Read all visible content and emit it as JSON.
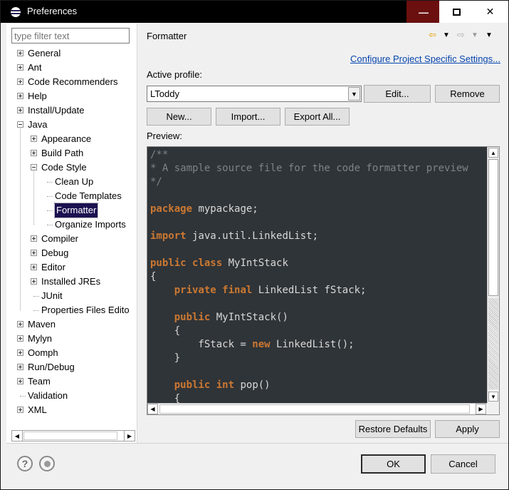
{
  "window": {
    "title": "Preferences"
  },
  "filter": {
    "placeholder": "type filter text"
  },
  "tree": [
    {
      "label": "General",
      "level": 0,
      "expander": "plus"
    },
    {
      "label": "Ant",
      "level": 0,
      "expander": "plus"
    },
    {
      "label": "Code Recommenders",
      "level": 0,
      "expander": "plus"
    },
    {
      "label": "Help",
      "level": 0,
      "expander": "plus"
    },
    {
      "label": "Install/Update",
      "level": 0,
      "expander": "plus"
    },
    {
      "label": "Java",
      "level": 0,
      "expander": "minus"
    },
    {
      "label": "Appearance",
      "level": 1,
      "expander": "plus"
    },
    {
      "label": "Build Path",
      "level": 1,
      "expander": "plus"
    },
    {
      "label": "Code Style",
      "level": 1,
      "expander": "minus"
    },
    {
      "label": "Clean Up",
      "level": 2,
      "expander": "none"
    },
    {
      "label": "Code Templates",
      "level": 2,
      "expander": "none"
    },
    {
      "label": "Formatter",
      "level": 2,
      "expander": "none",
      "selected": true
    },
    {
      "label": "Organize Imports",
      "level": 2,
      "expander": "none"
    },
    {
      "label": "Compiler",
      "level": 1,
      "expander": "plus"
    },
    {
      "label": "Debug",
      "level": 1,
      "expander": "plus"
    },
    {
      "label": "Editor",
      "level": 1,
      "expander": "plus"
    },
    {
      "label": "Installed JREs",
      "level": 1,
      "expander": "plus"
    },
    {
      "label": "JUnit",
      "level": 1,
      "expander": "none"
    },
    {
      "label": "Properties Files Edito",
      "level": 1,
      "expander": "none"
    },
    {
      "label": "Maven",
      "level": 0,
      "expander": "plus"
    },
    {
      "label": "Mylyn",
      "level": 0,
      "expander": "plus"
    },
    {
      "label": "Oomph",
      "level": 0,
      "expander": "plus"
    },
    {
      "label": "Run/Debug",
      "level": 0,
      "expander": "plus"
    },
    {
      "label": "Team",
      "level": 0,
      "expander": "plus"
    },
    {
      "label": "Validation",
      "level": 0,
      "expander": "none"
    },
    {
      "label": "XML",
      "level": 0,
      "expander": "plus"
    }
  ],
  "page": {
    "title": "Formatter",
    "configure_link": "Configure Project Specific Settings...",
    "active_profile_label": "Active profile:",
    "profile_value": "LToddy",
    "edit_button": "Edit...",
    "remove_button": "Remove",
    "new_button": "New...",
    "import_button": "Import...",
    "export_button": "Export All...",
    "preview_label": "Preview:",
    "restore_button": "Restore Defaults",
    "apply_button": "Apply"
  },
  "preview_code": [
    [
      {
        "t": "/**",
        "c": "cm"
      }
    ],
    [
      {
        "t": "* A sample source file for the code formatter preview",
        "c": "cm"
      }
    ],
    [
      {
        "t": "*/",
        "c": "cm"
      }
    ],
    [],
    [
      {
        "t": "package",
        "c": "kw"
      },
      {
        "t": " mypackage;",
        "c": "plain"
      }
    ],
    [],
    [
      {
        "t": "import",
        "c": "kw"
      },
      {
        "t": " java.util.LinkedList;",
        "c": "plain"
      }
    ],
    [],
    [
      {
        "t": "public",
        "c": "kw"
      },
      {
        "t": " ",
        "c": "plain"
      },
      {
        "t": "class",
        "c": "kw"
      },
      {
        "t": " MyIntStack",
        "c": "plain"
      }
    ],
    [
      {
        "t": "{",
        "c": "plain"
      }
    ],
    [
      {
        "t": "    ",
        "c": "plain"
      },
      {
        "t": "private",
        "c": "kw"
      },
      {
        "t": " ",
        "c": "plain"
      },
      {
        "t": "final",
        "c": "kw"
      },
      {
        "t": " LinkedList fStack;",
        "c": "plain"
      }
    ],
    [],
    [
      {
        "t": "    ",
        "c": "plain"
      },
      {
        "t": "public",
        "c": "kw"
      },
      {
        "t": " MyIntStack()",
        "c": "plain"
      }
    ],
    [
      {
        "t": "    {",
        "c": "plain"
      }
    ],
    [
      {
        "t": "        fStack = ",
        "c": "plain"
      },
      {
        "t": "new",
        "c": "kw"
      },
      {
        "t": " LinkedList();",
        "c": "plain"
      }
    ],
    [
      {
        "t": "    }",
        "c": "plain"
      }
    ],
    [],
    [
      {
        "t": "    ",
        "c": "plain"
      },
      {
        "t": "public",
        "c": "kw"
      },
      {
        "t": " ",
        "c": "plain"
      },
      {
        "t": "int",
        "c": "kw"
      },
      {
        "t": " pop()",
        "c": "plain"
      }
    ],
    [
      {
        "t": "    {",
        "c": "plain"
      }
    ]
  ],
  "dialog": {
    "ok_button": "OK",
    "cancel_button": "Cancel"
  },
  "icons": {
    "help": "help-icon",
    "import_export": "import-export-icon",
    "back": "back-arrow-icon",
    "forward": "forward-arrow-icon",
    "menu": "view-menu-icon"
  },
  "colors": {
    "keyword": "#cc7832",
    "comment": "#7b848a",
    "editor_bg": "#2f3438",
    "selection": "#1c1150",
    "link": "#0645ad"
  }
}
